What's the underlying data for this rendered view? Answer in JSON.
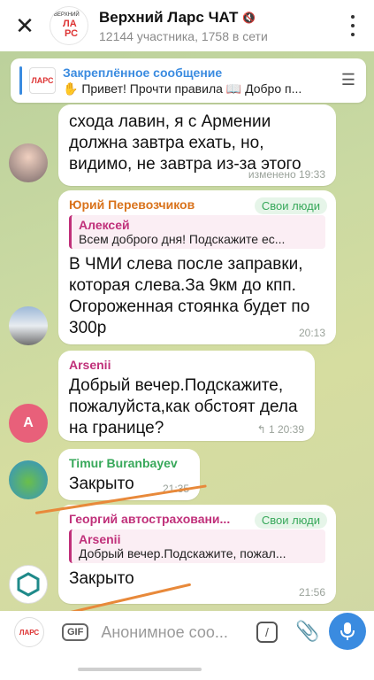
{
  "header": {
    "close_glyph": "✕",
    "title": "Верхний Ларс ЧАТ",
    "subtitle": "12144 участника, 1758 в сети",
    "logo_text_1": "ВЕРХНИЙ",
    "logo_text_2": "ЛА",
    "logo_text_3": "РС"
  },
  "pinned": {
    "title": "Закреплённое сообщение",
    "message": "✋ Привет! Прочти правила 📖 Добро п...",
    "thumb_text": "ЛАРС"
  },
  "messages": [
    {
      "text": "схода лавин, я с Армении должна завтра ехать, но, видимо, не завтра из-за этого",
      "time": "изменено 19:33"
    },
    {
      "sender": "Юрий Перевозчиков",
      "tag": "Свои люди",
      "reply_name": "Алексей",
      "reply_text": "Всем доброго дня! Подскажите ес...",
      "text": "В ЧМИ слева после заправки, которая слева.За 9км до кпп. Огороженная стоянка будет по 300р",
      "time": "20:13"
    },
    {
      "sender": "Arsenii",
      "avatar_letter": "A",
      "text": "Добрый вечер.Подскажите, пожалуйста,как обстоят дела на границе?",
      "time": "↰ 1  20:39"
    },
    {
      "sender": "Timur Buranbayev",
      "text": "Закрыто",
      "time": "21:35"
    },
    {
      "sender": "Георгий автостраховани...",
      "tag": "Свои люди",
      "reply_name": "Arsenii",
      "reply_text": "Добрый вечер.Подскажите, пожал...",
      "text": "Закрыто",
      "time": "21:56"
    }
  ],
  "input": {
    "placeholder": "Анонимное соо...",
    "gif_label": "GIF",
    "avatar_text": "ЛАРС"
  },
  "colors": {
    "accent": "#3a8be0",
    "sender_orange": "#d9731c",
    "sender_pink": "#c0307a",
    "tag_green": "#37a85a",
    "annotation": "#e8893a"
  }
}
